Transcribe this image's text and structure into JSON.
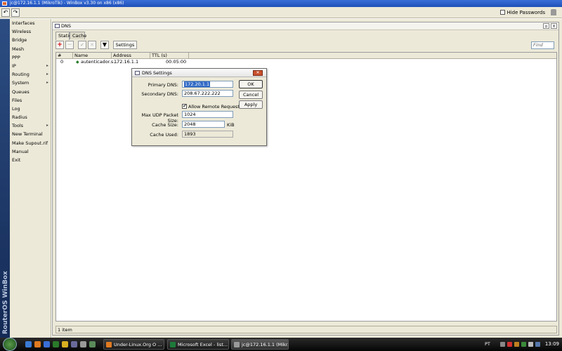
{
  "window": {
    "title": "jc@172.16.1.1 (MikroTik) - WinBox v3.30 on x86 (x86)"
  },
  "toolbar": {
    "undo_glyph": "↶",
    "redo_glyph": "↷",
    "hide_passwords_label": "Hide Passwords",
    "hide_passwords_checked": false
  },
  "sidebar": {
    "brand": "RouterOS WinBox",
    "items": [
      {
        "label": "Interfaces",
        "submenu": false
      },
      {
        "label": "Wireless",
        "submenu": false
      },
      {
        "label": "Bridge",
        "submenu": false
      },
      {
        "label": "Mesh",
        "submenu": false
      },
      {
        "label": "PPP",
        "submenu": false
      },
      {
        "label": "IP",
        "submenu": true
      },
      {
        "label": "Routing",
        "submenu": true
      },
      {
        "label": "System",
        "submenu": true
      },
      {
        "label": "Queues",
        "submenu": false
      },
      {
        "label": "Files",
        "submenu": false
      },
      {
        "label": "Log",
        "submenu": false
      },
      {
        "label": "Radius",
        "submenu": false
      },
      {
        "label": "Tools",
        "submenu": true
      },
      {
        "label": "New Terminal",
        "submenu": false
      },
      {
        "label": "Make Supout.rif",
        "submenu": false
      },
      {
        "label": "Manual",
        "submenu": false
      },
      {
        "label": "Exit",
        "submenu": false
      }
    ]
  },
  "dns_window": {
    "title": "DNS",
    "tabs": [
      "Static",
      "Cache"
    ],
    "active_tab": "Static",
    "settings_label": "Settings",
    "find_placeholder": "Find",
    "columns": [
      "#",
      "Name",
      "Address",
      "TTL (s)"
    ],
    "rows": [
      {
        "num": "0",
        "name": "autenticador.s...",
        "address": "172.16.1.1",
        "ttl": "00:05:00"
      }
    ],
    "status": "1 item"
  },
  "dns_settings": {
    "title": "DNS Settings",
    "primary_dns_label": "Primary DNS:",
    "primary_dns_value": "172.20.1.1",
    "secondary_dns_label": "Secondary DNS:",
    "secondary_dns_value": "208.67.222.222",
    "allow_remote_label": "Allow Remote Requests",
    "allow_remote_checked": true,
    "max_udp_label": "Max UDP Packet Size:",
    "max_udp_value": "1024",
    "cache_size_label": "Cache Size:",
    "cache_size_value": "2048",
    "cache_size_unit": "KiB",
    "cache_used_label": "Cache Used:",
    "cache_used_value": "1893",
    "ok_label": "OK",
    "cancel_label": "Cancel",
    "apply_label": "Apply"
  },
  "taskbar": {
    "tasks": [
      {
        "label": "Under-Linux.Org O ...",
        "active": false
      },
      {
        "label": "Microsoft Excel - list...",
        "active": false
      },
      {
        "label": "jc@172.16.1.1 (Mikr...",
        "active": true
      }
    ],
    "language": "PT",
    "clock": "13:09"
  },
  "colors": {
    "title_bar": "#2a5cc8",
    "panel": "#ece9d8",
    "selection": "#316ac5",
    "close_button": "#c9502e",
    "taskbar": "#111111"
  }
}
